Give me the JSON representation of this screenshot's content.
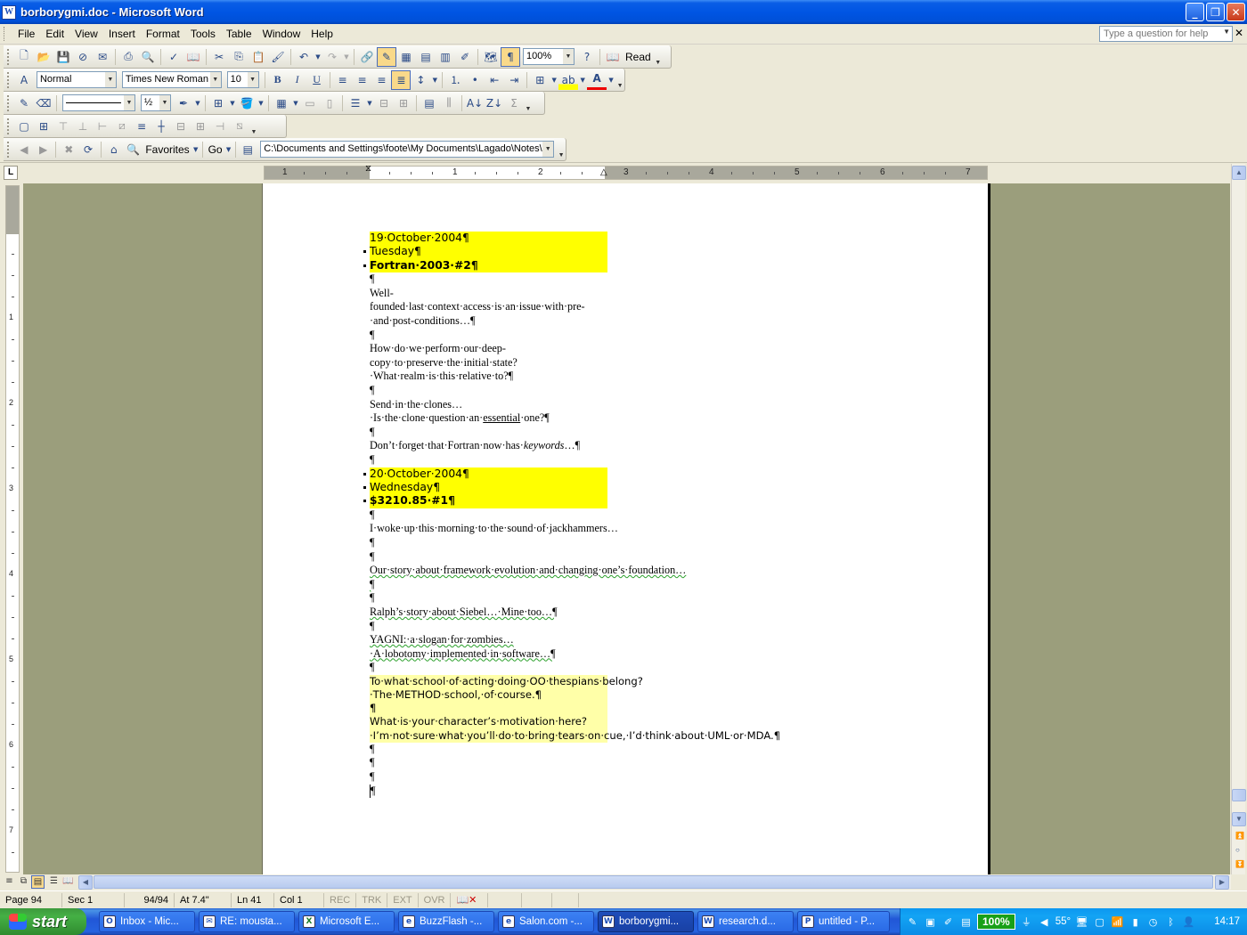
{
  "window": {
    "title": "borborygmi.doc - Microsoft Word",
    "app_icon_label": "W"
  },
  "menu": {
    "items": [
      "File",
      "Edit",
      "View",
      "Insert",
      "Format",
      "Tools",
      "Table",
      "Window",
      "Help"
    ],
    "help_placeholder": "Type a question for help"
  },
  "toolbar_standard": {
    "zoom": "100%",
    "read_label": "Read"
  },
  "toolbar_formatting": {
    "style": "Normal",
    "font": "Times New Roman",
    "size": "10"
  },
  "toolbar_drawing": {
    "line_weight": "½"
  },
  "toolbar_web": {
    "favorites_label": "Favorites",
    "go_label": "Go",
    "address": "C:\\Documents and Settings\\foote\\My Documents\\Lagado\\Notes\\E"
  },
  "ruler": {
    "h_numbers": [
      "1",
      "1",
      "2",
      "3",
      "4",
      "5",
      "6",
      "7"
    ],
    "v_numbers": [
      "1",
      "2",
      "3",
      "4",
      "5",
      "6",
      "7"
    ]
  },
  "document": {
    "entry1": {
      "date": "19·October·2004¶",
      "day": "Tuesday¶",
      "heading": "Fortran·2003·#2¶"
    },
    "p1_a": "Well-founded·last·context·access·is·an·issue·with·pre-·and·post-conditions…¶",
    "p2_a": "How·do·we·perform·our·deep-copy·to·preserve·the·initial·state?·What·realm·is·this·relative·to?¶",
    "p3_a": "Send·in·the·clones…·Is·the·clone·question·an·",
    "p3_u": "essential",
    "p3_b": "·one?¶",
    "p4_a": "Don’t·forget·that·Fortran·now·has·",
    "p4_i": "keywords",
    "p4_b": "…¶",
    "entry2": {
      "date": "20·October·2004¶",
      "day": "Wednesday¶",
      "heading": "$3210.85·#1¶"
    },
    "p5": "I·woke·up·this·morning·to·the·sound·of·jackhammers…¶",
    "p6": "Our·story·about·framework·evolution·and·changing·one’s·foundation…¶",
    "p7": "Ralph’s·story·about·Siebel…·Mine·too…¶",
    "p8": "YAGNI:·a·slogan·for·zombies…·A·lobotomy·implemented·in·software…¶",
    "p9": "To·what·school·of·acting·doing·OO·thespians·belong?·The·METHOD·school,·of·course.¶",
    "p10": "What·is·your·character’s·motivation·here?·I’m·not·sure·what·you’ll·do·to·bring·tears·on·cue,·I’d·think·about·UML·or·MDA.¶",
    "pilcrow": "¶"
  },
  "status": {
    "page": "Page 94",
    "sec": "Sec 1",
    "pages": "94/94",
    "at": "At 7.4\"",
    "ln": "Ln 41",
    "col": "Col 1",
    "rec": "REC",
    "trk": "TRK",
    "ext": "EXT",
    "ovr": "OVR"
  },
  "taskbar": {
    "start_label": "start",
    "tasks": [
      "Inbox - Mic...",
      "RE: mousta...",
      "Microsoft E...",
      "BuzzFlash -...",
      "Salon.com -...",
      "borborygmi...",
      "research.d...",
      "untitled - P..."
    ],
    "battery": "100%",
    "temp": "55°",
    "clock": "14:17"
  },
  "colors": {
    "highlight": "#ffff00",
    "light_highlight": "#ffffa8",
    "doc_background": "#9b9e7c",
    "titlebar": "#0055e3"
  }
}
